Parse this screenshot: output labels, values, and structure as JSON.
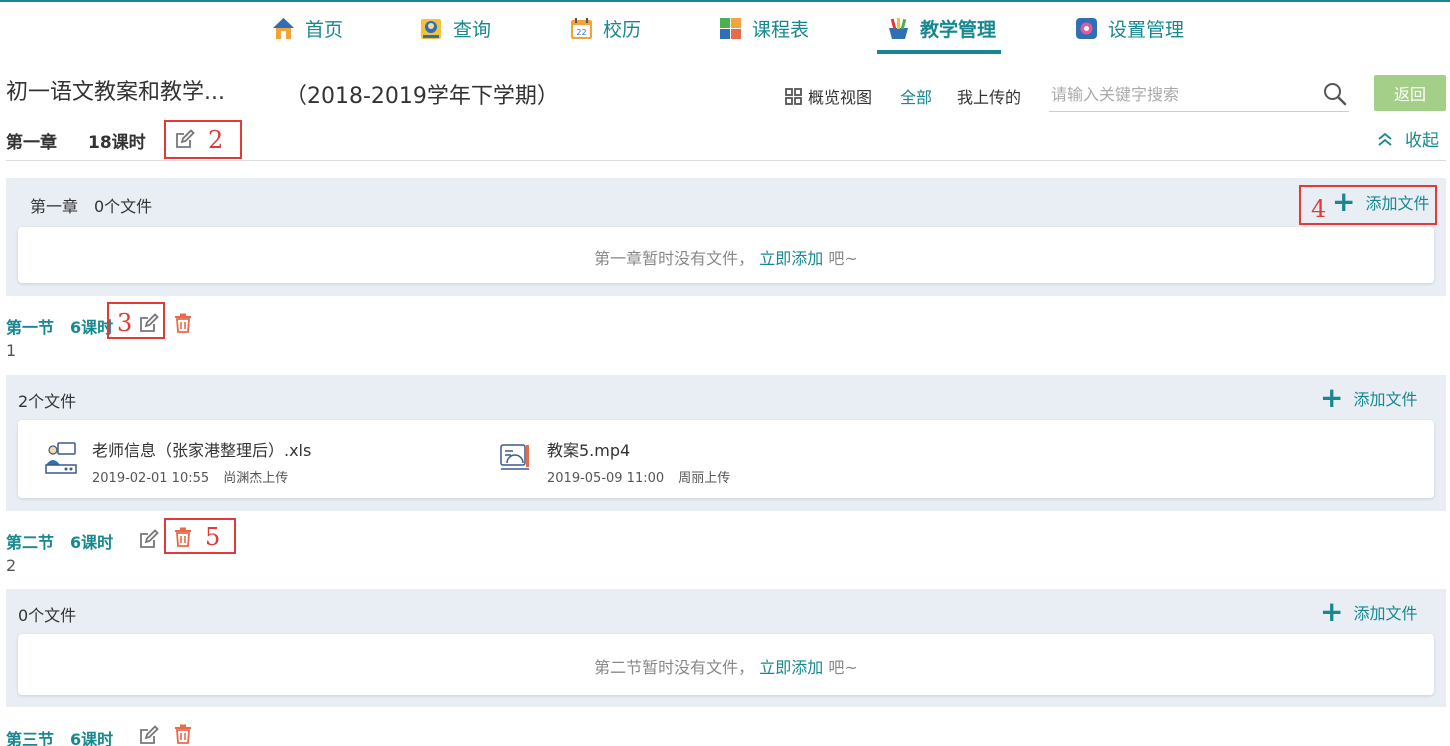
{
  "nav": {
    "items": [
      {
        "label": "首页",
        "icon": "home-icon"
      },
      {
        "label": "查询",
        "icon": "search-person-icon"
      },
      {
        "label": "校历",
        "icon": "calendar-icon"
      },
      {
        "label": "课程表",
        "icon": "timetable-icon"
      },
      {
        "label": "教学管理",
        "icon": "teaching-icon",
        "active": true
      },
      {
        "label": "设置管理",
        "icon": "settings-icon"
      }
    ]
  },
  "header": {
    "title": "初一语文教案和教学...",
    "semester": "（2018-2019学年下学期）",
    "overview_label": "概览视图",
    "filter_all": "全部",
    "filter_mine": "我上传的",
    "search_placeholder": "请输入关键字搜索",
    "back_label": "返回"
  },
  "chapter": {
    "name": "第一章",
    "hours": "18课时",
    "collapse_label": "收起",
    "panel_head": "第一章　0个文件",
    "add_label": "添加文件",
    "empty_prefix": "第一章暂时没有文件，",
    "empty_link": "立即添加",
    "empty_suffix": " 吧~"
  },
  "sections": [
    {
      "title": "第一节　6课时",
      "desc": "1",
      "panel_head": "2个文件",
      "add_label": "添加文件",
      "files": [
        {
          "name": "老师信息（张家港整理后）.xls",
          "date": "2019-02-01 10:55",
          "uploader": "尚渊杰上传",
          "icon": "teacher-file-icon"
        },
        {
          "name": "教案5.mp4",
          "date": "2019-05-09 11:00",
          "uploader": "周丽上传",
          "icon": "lesson-video-icon"
        }
      ]
    },
    {
      "title": "第二节　6课时",
      "desc": "2",
      "panel_head": "0个文件",
      "add_label": "添加文件",
      "empty_prefix": "第二节暂时没有文件，",
      "empty_link": "立即添加",
      "empty_suffix": " 吧~"
    },
    {
      "title": "第三节　6课时"
    }
  ],
  "annotations": [
    "2",
    "3",
    "4",
    "5"
  ],
  "colors": {
    "accent": "#17888f",
    "annotation": "#e03a3a",
    "back_button": "#a4cf88",
    "delete": "#e86a4a"
  }
}
